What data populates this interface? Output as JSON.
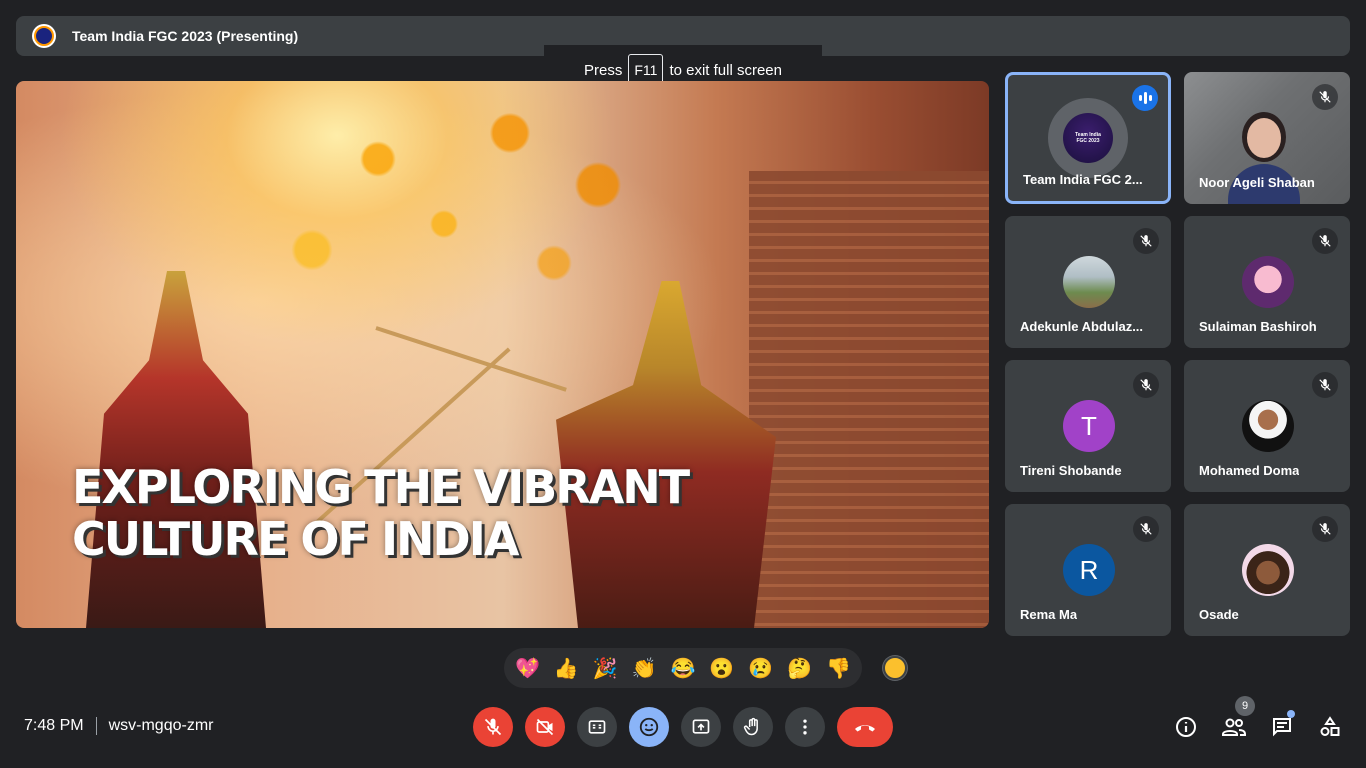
{
  "meeting": {
    "title": "Team India FGC 2023 (Presenting)",
    "time": "7:48 PM",
    "code": "wsv-mgqo-zmr"
  },
  "fullscreen_toast": {
    "prefix": "Press",
    "key": "F11",
    "suffix": "to exit full screen"
  },
  "slide": {
    "title": "EXPLORING THE VIBRANT\nCULTURE OF INDIA"
  },
  "participants": [
    {
      "name": "Team India FGC 2...",
      "speaking": true,
      "avatar_type": "logo",
      "logo_text": [
        "Team India",
        "FGC 2023"
      ]
    },
    {
      "name": "Noor Ageli Shaban",
      "muted": true,
      "avatar_type": "video"
    },
    {
      "name": "Adekunle Abdulaz...",
      "muted": true,
      "avatar_type": "photo"
    },
    {
      "name": "Sulaiman Bashiroh",
      "muted": true,
      "avatar_type": "photo"
    },
    {
      "name": "Tireni Shobande",
      "muted": true,
      "avatar_type": "letter",
      "letter": "T",
      "color": "#a142c8"
    },
    {
      "name": "Mohamed Doma",
      "muted": true,
      "avatar_type": "photo"
    },
    {
      "name": "Rema Ma",
      "muted": true,
      "avatar_type": "letter",
      "letter": "R",
      "color": "#0b57a0"
    },
    {
      "name": "Osade",
      "muted": true,
      "avatar_type": "photo"
    }
  ],
  "reactions": [
    "💖",
    "👍",
    "🎉",
    "👏",
    "😂",
    "😮",
    "😢",
    "🤔",
    "👎"
  ],
  "people_count": "9",
  "colors": {
    "background": "#202124",
    "tile": "#3c4043",
    "danger": "#ea4335",
    "accent": "#8ab4f8"
  },
  "controls": {
    "mic": "mic-off-icon",
    "camera": "camera-off-icon",
    "captions": "captions-icon",
    "emoji": "emoji-icon",
    "present": "present-icon",
    "hand": "raise-hand-icon",
    "more": "more-options-icon",
    "leave": "end-call-icon"
  }
}
